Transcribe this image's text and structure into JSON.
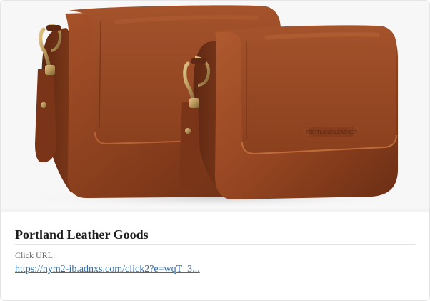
{
  "ad_card": {
    "title": "Portland Leather Goods",
    "click_label": "Click URL:",
    "click_url": "https://nym2-ib.adnxs.com/click2?e=wqT_3...",
    "image_alt": "Two brown leather crossbody bags with brass clasps",
    "brand_stamp_text": "PORTLAND LEATHER"
  },
  "colors": {
    "title": "#1c1c1c",
    "label": "#6e6e6e",
    "link": "#2a6db0",
    "leather": "#8a3f1d",
    "leather_dark": "#5e2812",
    "brass": "#b8965a"
  }
}
